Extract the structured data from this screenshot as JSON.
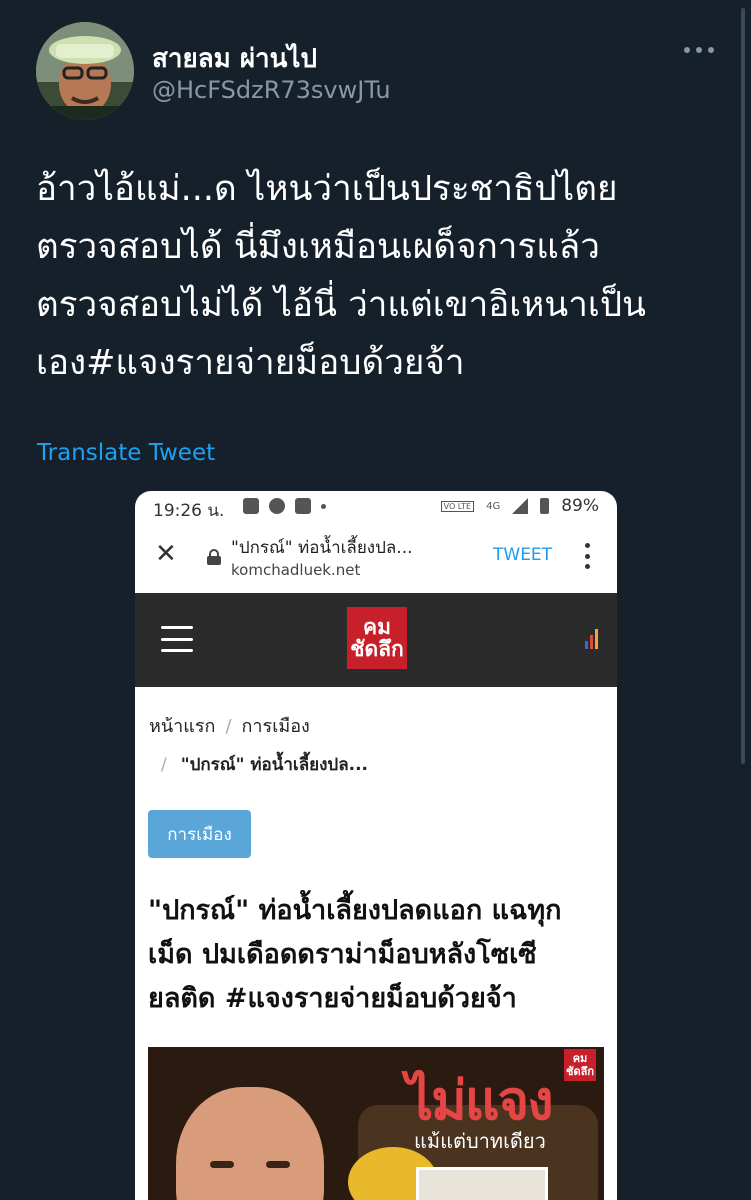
{
  "colors": {
    "background": "#15202b",
    "text_primary": "#ffffff",
    "text_secondary": "#8899a6",
    "link_blue": "#1da1f2",
    "site_red": "#c8202b",
    "category_badge": "#5aa6d8"
  },
  "tweet": {
    "display_name": "สายลม ผ่านไป",
    "handle": "@HcFSdzR73svwJTu",
    "text_lines": [
      "อ้าวไอ้แม่...ด ไหนว่าเป็นประชาธิปไตย",
      "ตรวจสอบได้ นี่มึงเหมือนเผด็จการแล้ว",
      "ตรวจสอบไม่ได้ ไอ้นี่ ว่าแต่เขาอิเหนาเป็น",
      "เอง#แจงรายจ่ายม็อบด้วยจ้า"
    ],
    "translate_label": "Translate Tweet"
  },
  "phone": {
    "status_bar": {
      "time": "19:26 น.",
      "volte_label": "VO LTE",
      "network_label": "4G",
      "battery": "89%"
    },
    "browser": {
      "page_title": "\"ปกรณ์\" ท่อน้ำเลี้ยงปล...",
      "domain": "komchadluek.net",
      "tweet_button": "TWEET"
    },
    "site": {
      "logo_text": "คม ชัดลึก",
      "breadcrumb": {
        "home": "หน้าแรก",
        "section": "การเมือง",
        "current": "\"ปกรณ์\" ท่อน้ำเลี้ยงปล..."
      },
      "category_badge": "การเมือง",
      "headline_lines": [
        "\"ปกรณ์\" ท่อน้ำเลี้ยงปลดแอก แฉทุก",
        "เม็ด ปมเดือดดราม่าม็อบหลังโซเซี",
        "ยลติด #แจงรายจ่ายม็อบด้วยจ้า"
      ],
      "hero_image": {
        "headline": "ไม่แจง",
        "subline": "แม้แต่บาทเดียว",
        "logo_text": "คม ชัดลึก"
      }
    }
  }
}
